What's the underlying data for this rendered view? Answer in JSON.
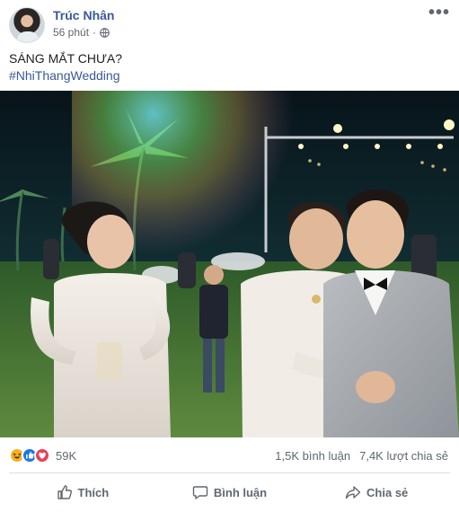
{
  "post": {
    "author": "Trúc Nhân",
    "time": "56 phút",
    "privacy_icon": "globe-icon",
    "more_icon": "more-options-icon",
    "caption": "SÁNG MẮT CHƯA?",
    "hashtag": "#NhiThangWedding"
  },
  "engagement": {
    "reactions": [
      "haha",
      "like",
      "love"
    ],
    "reaction_colors": {
      "haha": "#f7b125",
      "like": "#1877f2",
      "love": "#e9405a"
    },
    "reaction_count": "59K",
    "comments": "1,5K bình luận",
    "shares": "7,4K lượt chia sẻ"
  },
  "actions": {
    "like": "Thích",
    "comment": "Bình luận",
    "share": "Chia sẻ"
  },
  "colors": {
    "link": "#385898",
    "muted": "#606770",
    "divider": "#dadde1"
  }
}
